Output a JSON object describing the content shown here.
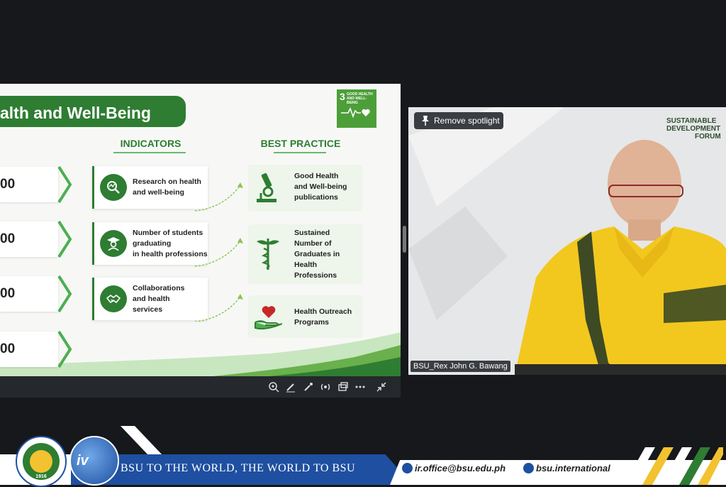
{
  "slide": {
    "title": "alth and Well-Being",
    "sdg_badge": {
      "number": "3",
      "label": "GOOD HEALTH AND WELL-BEING"
    },
    "columns": {
      "indicators": "INDICATORS",
      "best_practice": "BEST PRACTICE"
    },
    "left_values": [
      "00",
      "00",
      "00",
      "00"
    ],
    "indicators": [
      {
        "line1": "Research on health",
        "line2": "and well-being",
        "line3": ""
      },
      {
        "line1": "Number of students",
        "line2": "graduating",
        "line3": "in health professions"
      },
      {
        "line1": "Collaborations",
        "line2": "and health",
        "line3": "services"
      }
    ],
    "best_practices": [
      {
        "lines": [
          "Good Health",
          "and Well-being",
          "publications"
        ]
      },
      {
        "lines": [
          "Sustained",
          "Number of",
          "Graduates in",
          "Health",
          "Professions"
        ]
      },
      {
        "lines": [
          "Health Outreach",
          "Programs"
        ]
      }
    ]
  },
  "video": {
    "spotlight_button": "Remove spotlight",
    "participant_name": "BSU_Rex John G. Bawang",
    "brand_lines": [
      "SUSTAINABLE",
      "DEVELOPMENT",
      "FORUM"
    ]
  },
  "footer": {
    "tagline": "BSU TO THE WORLD, THE WORLD TO BSU",
    "email": "ir.office@bsu.edu.ph",
    "web": "bsu.international",
    "seal_year": "1916"
  },
  "colors": {
    "green": "#2e7d32",
    "blue": "#1f4fa0",
    "yellow": "#f2c230"
  }
}
